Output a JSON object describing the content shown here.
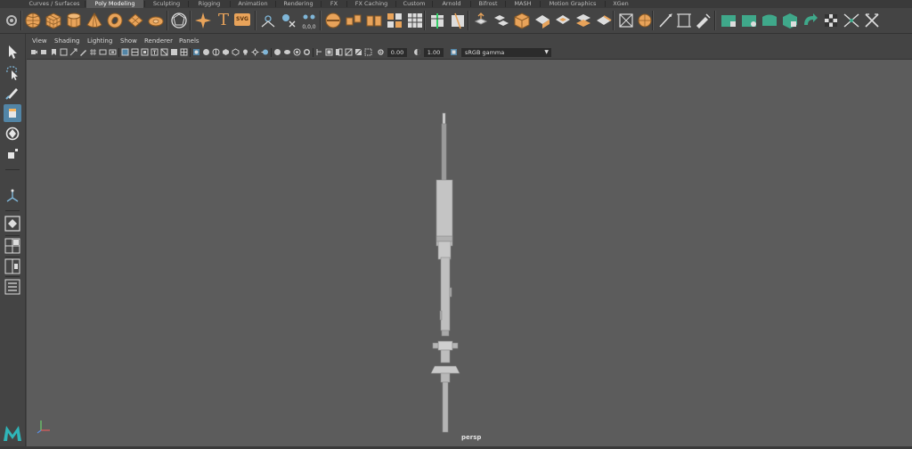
{
  "shelf_tabs": [
    {
      "label": "Curves / Surfaces",
      "active": false
    },
    {
      "label": "Poly Modeling",
      "active": true
    },
    {
      "label": "Sculpting",
      "active": false
    },
    {
      "label": "Rigging",
      "active": false
    },
    {
      "label": "Animation",
      "active": false
    },
    {
      "label": "Rendering",
      "active": false
    },
    {
      "label": "FX",
      "active": false
    },
    {
      "label": "FX Caching",
      "active": false
    },
    {
      "label": "Custom",
      "active": false
    },
    {
      "label": "Arnold",
      "active": false
    },
    {
      "label": "Bifrost",
      "active": false
    },
    {
      "label": "MASH",
      "active": false
    },
    {
      "label": "Motion Graphics",
      "active": false
    },
    {
      "label": "XGen",
      "active": false
    }
  ],
  "shelf_icons": [
    "poly-sphere-icon",
    "poly-cube-icon",
    "poly-cylinder-icon",
    "poly-cone-icon",
    "poly-torus-icon",
    "poly-plane-icon",
    "poly-disc-icon",
    "platonic-solid-icon",
    "super-shape-icon",
    "type-text-icon",
    "svg-icon",
    "bevel-mirror-icon",
    "combine-icon",
    "separate-icon",
    "smooth-icon",
    "extract-icon",
    "boolean-icon",
    "mirror-icon",
    "grid-icon",
    "edge-loop-icon",
    "multi-cut-icon",
    "extrude-icon",
    "bridge-icon",
    "bevel-icon",
    "append-icon",
    "fill-hole-icon",
    "merge-icon",
    "target-weld-icon",
    "collapse-icon",
    "bend-icon",
    "lattice-icon",
    "sculpt-icon",
    "uv-editor-icon",
    "unfold-icon",
    "layout-icon",
    "cut-uv-icon",
    "sew-icon",
    "delete-history-icon",
    "center-pivot-icon",
    "freeze-icon",
    "checker-icon",
    "symmetry-icon",
    "retopo-icon"
  ],
  "shelf_icon_special_text": {
    "type": "T",
    "svg": "SVG"
  },
  "panel_menu": [
    "View",
    "Shading",
    "Lighting",
    "Show",
    "Renderer",
    "Panels"
  ],
  "panel_toolbar": {
    "exposure": "0.00",
    "gamma": "1.00",
    "color_space": "sRGB gamma"
  },
  "viewport": {
    "camera_label": "persp"
  },
  "colors": {
    "accent": "#5285a6",
    "shelf_orange": "#e8a35a",
    "viewport_bg": "#5c5c5c",
    "ui_bg": "#444444"
  }
}
